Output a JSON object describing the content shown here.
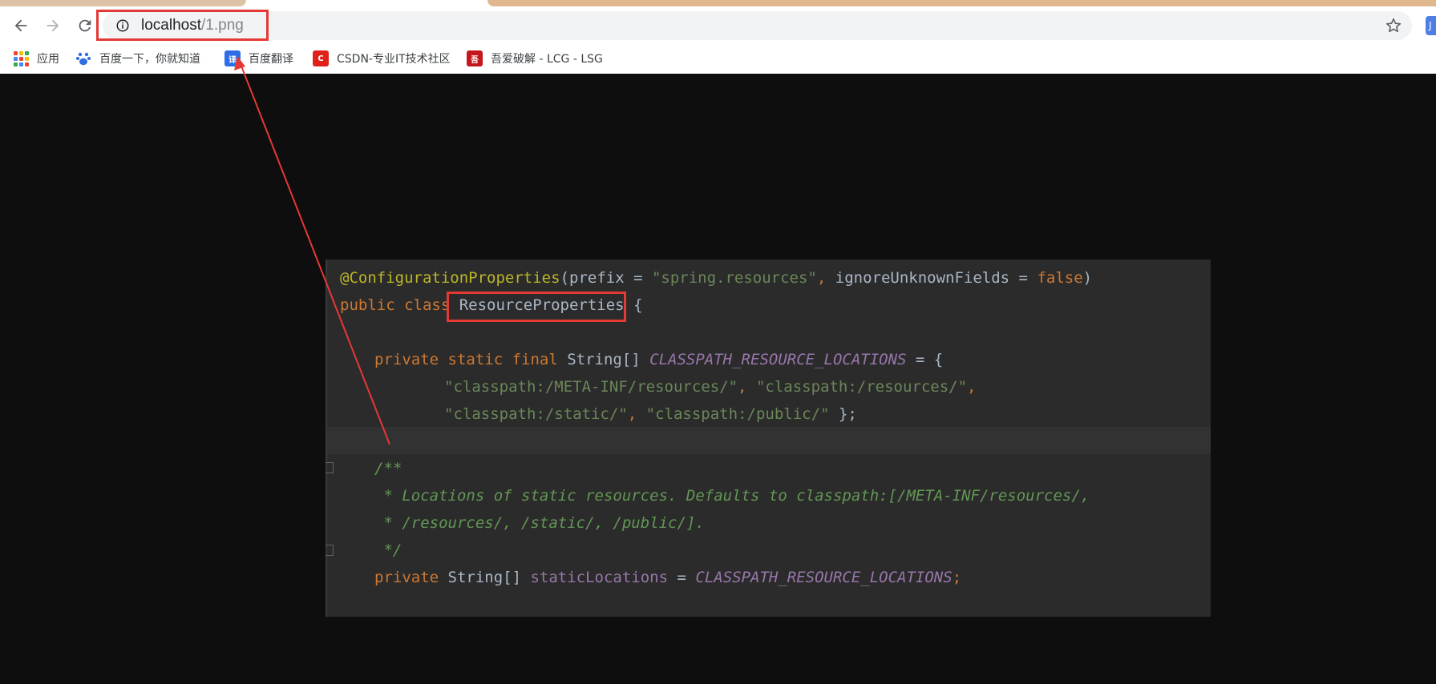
{
  "browser": {
    "url_host": "localhost",
    "url_path": "/1.png",
    "bookmarks": [
      {
        "label": "应用",
        "icon": "apps-grid-icon"
      },
      {
        "label": "百度一下，你就知道",
        "icon": "baidu-paw-icon"
      },
      {
        "label": "百度翻译",
        "icon": "baidu-translate-icon",
        "icon_text": "译"
      },
      {
        "label": "CSDN-专业IT技术社区",
        "icon": "csdn-icon",
        "icon_text": "C"
      },
      {
        "label": "吾爱破解 - LCG - LSG",
        "icon": "52pojie-icon",
        "icon_text": "吾"
      }
    ],
    "extension_label": "J"
  },
  "code": {
    "line1": {
      "annotation": "@ConfigurationProperties",
      "open_paren": "(",
      "param1": "prefix",
      "eq1": " = ",
      "value1": "\"spring.resources\"",
      "comma": ", ",
      "param2": "ignoreUnknownFields",
      "eq2": " = ",
      "value2": "false",
      "close_paren": ")"
    },
    "line2": {
      "kw_public": "public ",
      "kw_class": "class ",
      "class_name": "ResourceProperties",
      "brace": " {"
    },
    "line3": {
      "kw": "private static final ",
      "type": "String[] ",
      "constant": "CLASSPATH_RESOURCE_LOCATIONS",
      "assign": " = {"
    },
    "line4": {
      "str1": "\"classpath:/META-INF/resources/\"",
      "sep": ", ",
      "str2": "\"classpath:/resources/\"",
      "end": ","
    },
    "line5": {
      "str1": "\"classpath:/static/\"",
      "sep": ", ",
      "str2": "\"classpath:/public/\"",
      "end": " };"
    },
    "doc": {
      "open": "/**",
      "text1": " * Locations of static resources. Defaults to classpath:[/META-INF/resources/,",
      "text2": " * /resources/, /static/, /public/].",
      "close": " */"
    },
    "line_last": {
      "kw": "private ",
      "type": "String[] ",
      "field": "staticLocations",
      "assign": " = ",
      "constant": "CLASSPATH_RESOURCE_LOCATIONS",
      "end": ";"
    }
  },
  "colors": {
    "annotation_red": "#e53935",
    "editor_bg": "#2b2b2b",
    "keyword": "#cc7832",
    "string": "#6a8759",
    "annotation": "#bbb529",
    "constant": "#9876aa",
    "doc_comment": "#629755"
  }
}
